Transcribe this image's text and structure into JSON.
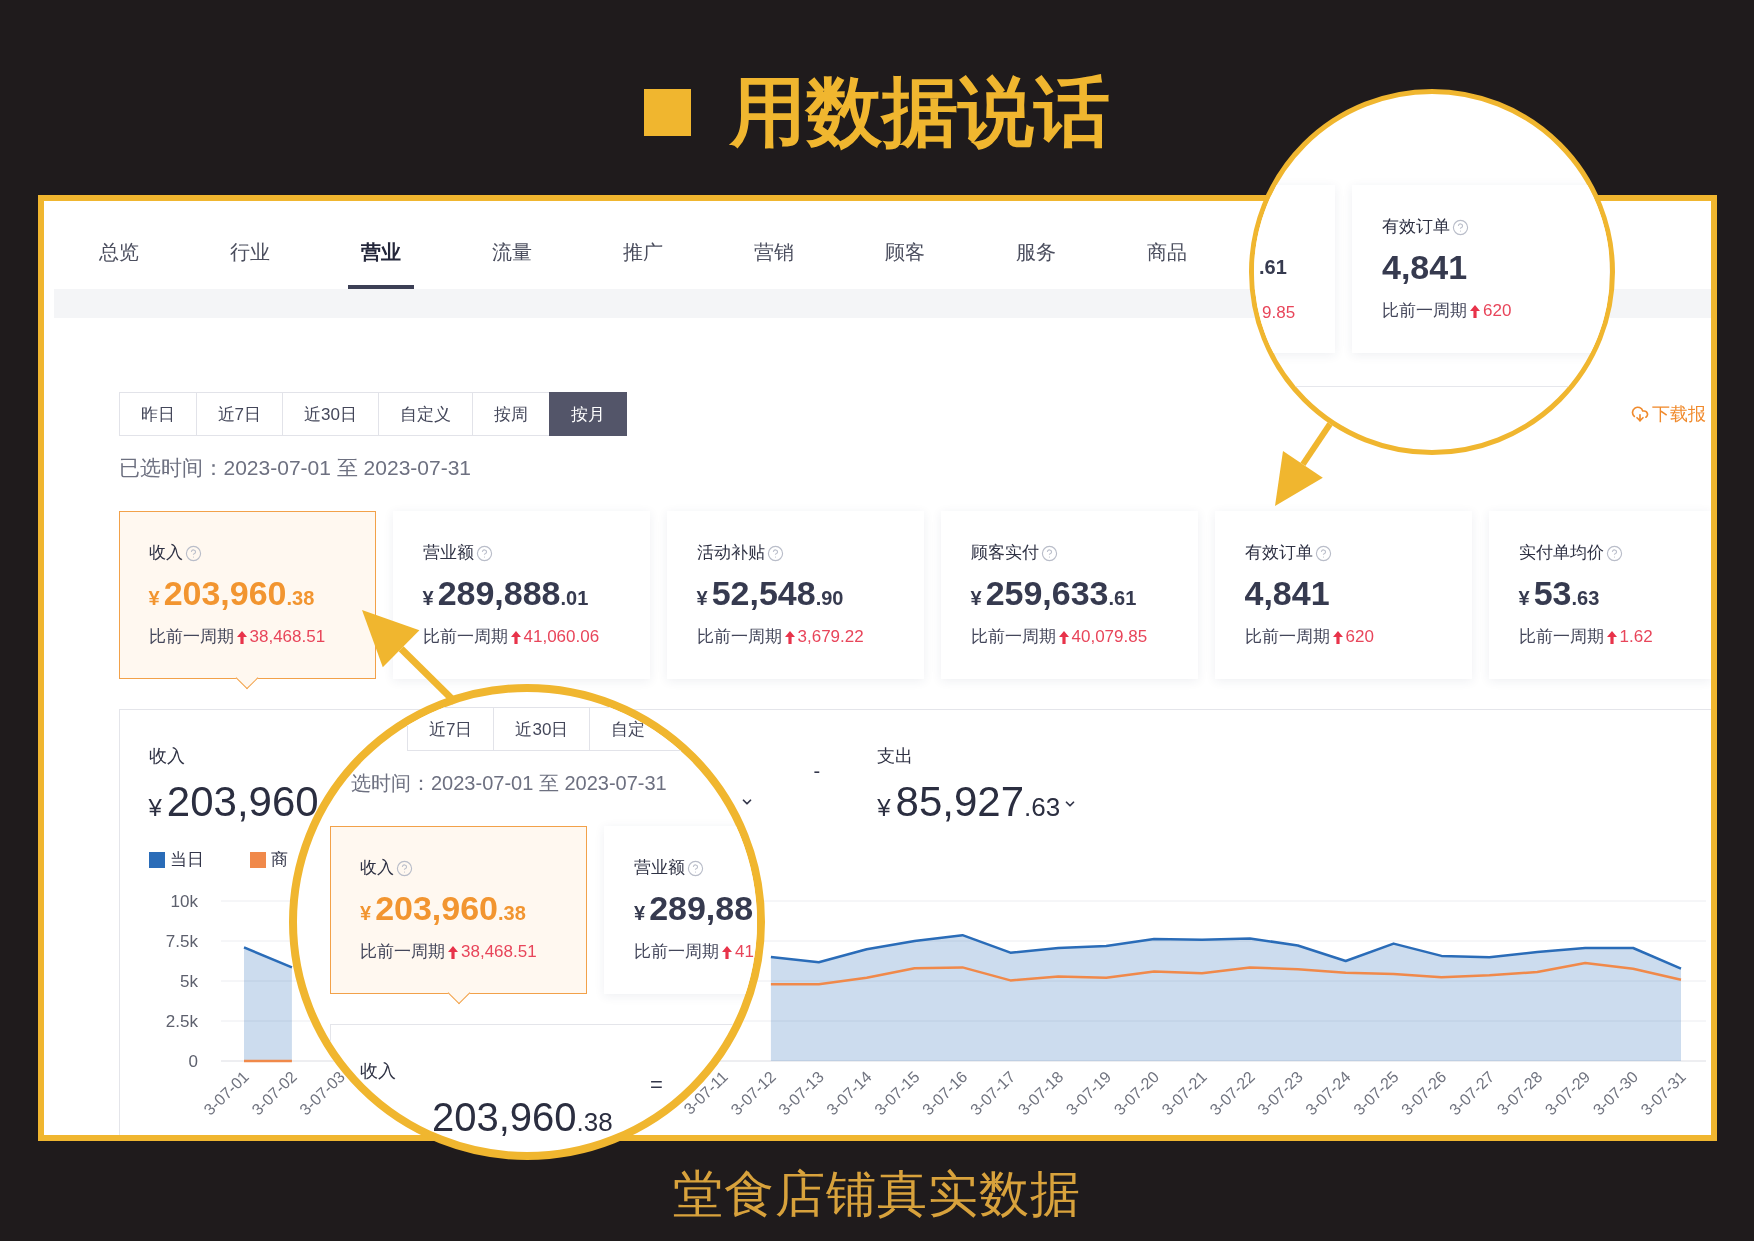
{
  "headline": {
    "text": "用数据说话"
  },
  "nav_tabs": [
    {
      "label": "总览",
      "selected": false
    },
    {
      "label": "行业",
      "selected": false
    },
    {
      "label": "营业",
      "selected": true
    },
    {
      "label": "流量",
      "selected": false
    },
    {
      "label": "推广",
      "selected": false
    },
    {
      "label": "营销",
      "selected": false
    },
    {
      "label": "顾客",
      "selected": false
    },
    {
      "label": "服务",
      "selected": false
    },
    {
      "label": "商品",
      "selected": false
    }
  ],
  "date_range_buttons": [
    {
      "label": "昨日",
      "selected": false
    },
    {
      "label": "近7日",
      "selected": false
    },
    {
      "label": "近30日",
      "selected": false
    },
    {
      "label": "自定义",
      "selected": false
    },
    {
      "label": "按周",
      "selected": false
    },
    {
      "label": "按月",
      "selected": true
    }
  ],
  "download_link": {
    "label": "下载报"
  },
  "selected_range": "已选时间：2023-07-01 至 2023-07-31",
  "metric_cards": [
    {
      "label": "收入",
      "currency": "¥",
      "integer": "203,960",
      "fraction": ".38",
      "compare_label": "比前一周期",
      "delta": "38,468.51",
      "selected": true
    },
    {
      "label": "营业额",
      "currency": "¥",
      "integer": "289,888",
      "fraction": ".01",
      "compare_label": "比前一周期",
      "delta": "41,060.06",
      "selected": false
    },
    {
      "label": "活动补贴",
      "currency": "¥",
      "integer": "52,548",
      "fraction": ".90",
      "compare_label": "比前一周期",
      "delta": "3,679.22",
      "selected": false
    },
    {
      "label": "顾客实付",
      "currency": "¥",
      "integer": "259,633",
      "fraction": ".61",
      "compare_label": "比前一周期",
      "delta": "40,079.85",
      "selected": false
    },
    {
      "label": "有效订单",
      "integer": "4,841",
      "compare_label": "比前一周期",
      "delta": "620",
      "selected": false
    },
    {
      "label": "实付单均价",
      "currency": "¥",
      "integer": "53",
      "fraction": ".63",
      "compare_label": "比前一周期",
      "delta": "1.62",
      "selected": false
    }
  ],
  "summary": {
    "income": {
      "label": "收入",
      "currency": "¥",
      "integer": "203,960"
    },
    "operator": "-",
    "expense": {
      "label": "支出",
      "currency": "¥",
      "integer": "85,927",
      "fraction": ".63"
    }
  },
  "chart_data": {
    "type": "area",
    "grid": true,
    "categories": [
      "3-07-01",
      "3-07-02",
      "3-07-03",
      null,
      null,
      null,
      null,
      null,
      null,
      null,
      "3-07-11",
      "3-07-12",
      "3-07-13",
      "3-07-14",
      "3-07-15",
      "3-07-16",
      "3-07-17",
      "3-07-18",
      "3-07-19",
      "3-07-20",
      "3-07-21",
      "3-07-22",
      "3-07-23",
      "3-07-24",
      "3-07-25",
      "3-07-26",
      "3-07-27",
      "3-07-28",
      "3-07-29",
      "3-07-30",
      "3-07-31"
    ],
    "series": [
      {
        "name": "当日",
        "type": "area",
        "color": "#2a6cb8",
        "values": [
          7100,
          5850,
          null,
          null,
          null,
          null,
          null,
          null,
          null,
          null,
          null,
          6500,
          6170,
          6980,
          7500,
          7860,
          6770,
          7060,
          7180,
          7620,
          7580,
          7660,
          7220,
          6250,
          7340,
          6570,
          6490,
          6810,
          7060,
          7060,
          5770
        ]
      },
      {
        "name": "商",
        "type": "line",
        "color": "#f0894a",
        "values": [
          0,
          0,
          null,
          null,
          null,
          null,
          null,
          null,
          null,
          null,
          null,
          4800,
          4800,
          5200,
          5800,
          5850,
          5040,
          5280,
          5200,
          5600,
          5480,
          5850,
          5730,
          5520,
          5440,
          5240,
          5360,
          5560,
          6130,
          5770,
          5080
        ]
      }
    ],
    "ylim": [
      0,
      10000
    ],
    "yticks": [
      {
        "value": 0,
        "label": "0"
      },
      {
        "value": 2500,
        "label": "2.5k"
      },
      {
        "value": 5000,
        "label": "5k"
      },
      {
        "value": 7500,
        "label": "7.5k"
      },
      {
        "value": 10000,
        "label": "10k"
      }
    ]
  },
  "magnifier_top": {
    "cards": [
      {
        "kind": "fragment",
        "fraction": ".61",
        "delta": "9.85",
        "selected": false
      },
      {
        "kind": "whole",
        "label": "有效订单",
        "integer": "4,841",
        "compare_label": "比前一周期",
        "delta": "620",
        "selected": false
      }
    ]
  },
  "magnifier_bottom": {
    "date_range_buttons": [
      {
        "label": "近7日",
        "kind": "whole",
        "selected": false
      },
      {
        "label": "近30日",
        "kind": "whole",
        "selected": false
      },
      {
        "label": "自定",
        "kind": "clipped",
        "selected": false
      }
    ],
    "selected_range": "选时间：2023-07-01 至 2023-07-31",
    "cards": [
      {
        "kind": "whole",
        "label": "收入",
        "currency": "¥",
        "integer": "203,960",
        "fraction": ".38",
        "compare_label": "比前一周期",
        "delta": "38,468.51",
        "selected": true
      },
      {
        "kind": "clipped",
        "label": "营业额",
        "currency": "¥",
        "integer": "289,88",
        "compare_label": "比前一周期",
        "delta": "41",
        "selected": false
      }
    ],
    "panel": {
      "label": "收入",
      "operator": "=",
      "integer": "203,960",
      "fraction": ".38"
    }
  },
  "caption": "堂食店铺真实数据"
}
